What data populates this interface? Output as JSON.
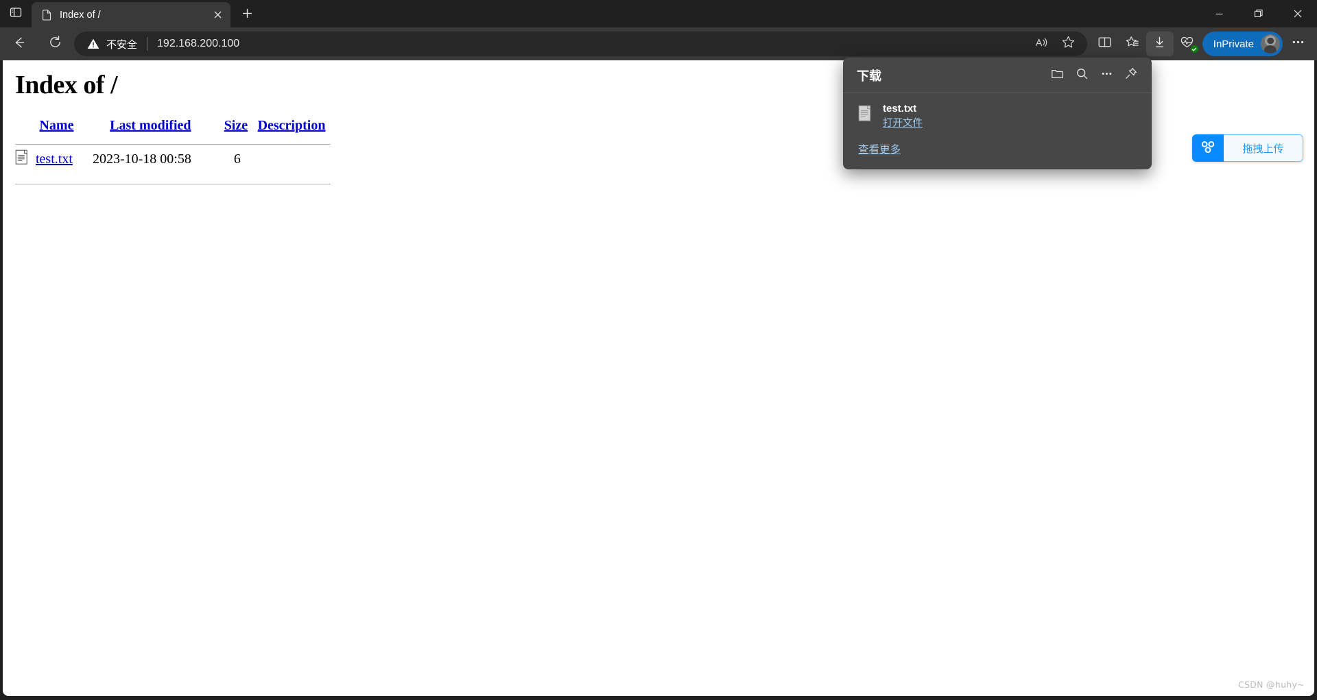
{
  "window": {
    "minimize_label": "Minimize",
    "restore_label": "Restore",
    "close_label": "Close"
  },
  "tabbar": {
    "tab_search_icon": "tab-search-icon",
    "new_tab_icon": "plus-icon",
    "tabs": [
      {
        "title": "Index of /",
        "favicon": "page-icon",
        "close_icon": "close-icon"
      }
    ]
  },
  "toolbar": {
    "back_icon": "back-arrow-icon",
    "refresh_icon": "reload-icon",
    "security_label": "不安全",
    "security_icon": "warning-triangle-icon",
    "url": "192.168.200.100",
    "read_aloud_icon": "read-aloud-icon",
    "favorite_icon": "star-icon",
    "split_screen_icon": "split-screen-icon",
    "collections_icon": "collections-icon",
    "downloads_icon": "download-icon",
    "browser_essentials_icon": "browser-essentials-icon",
    "inprivate_label": "InPrivate",
    "profile_icon": "avatar-icon",
    "settings_icon": "ellipsis-icon"
  },
  "page": {
    "title": "Index of /",
    "table": {
      "headers": [
        "Name",
        "Last modified",
        "Size",
        "Description"
      ],
      "rows": [
        {
          "icon": "text-file-icon",
          "name": "test.txt",
          "last_modified": "2023-10-18 00:58",
          "size": "6",
          "description": ""
        }
      ]
    }
  },
  "upload_widget": {
    "icon": "baidu-netdisk-icon",
    "label": "拖拽上传"
  },
  "downloads_panel": {
    "title": "下载",
    "folder_icon": "folder-icon",
    "search_icon": "search-icon",
    "more_icon": "ellipsis-icon",
    "pin_icon": "pin-icon",
    "items": [
      {
        "icon": "text-file-icon",
        "filename": "test.txt",
        "action_label": "打开文件"
      }
    ],
    "see_more_label": "查看更多"
  },
  "watermark": "CSDN @huhy~"
}
